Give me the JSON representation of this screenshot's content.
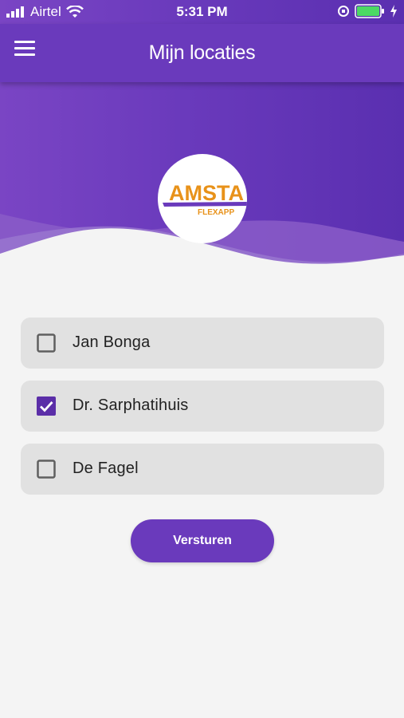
{
  "status_bar": {
    "carrier": "Airtel",
    "time": "5:31 PM",
    "battery_level_percent": 100
  },
  "app_bar": {
    "title": "Mijn locaties",
    "menu_icon": "hamburger-menu-icon"
  },
  "logo": {
    "line1": "AMSTA",
    "line2": "FLEXAPP",
    "text_color": "#e8921a"
  },
  "locations": [
    {
      "label": "Jan Bonga",
      "checked": false
    },
    {
      "label": "Dr. Sarphatihuis",
      "checked": true
    },
    {
      "label": "De Fagel",
      "checked": false
    }
  ],
  "submit": {
    "label": "Versturen"
  },
  "colors": {
    "primary": "#6a3abc",
    "checkbox_checked": "#5b2ea8",
    "item_background": "#e1e1e1",
    "page_background": "#f4f4f4"
  }
}
